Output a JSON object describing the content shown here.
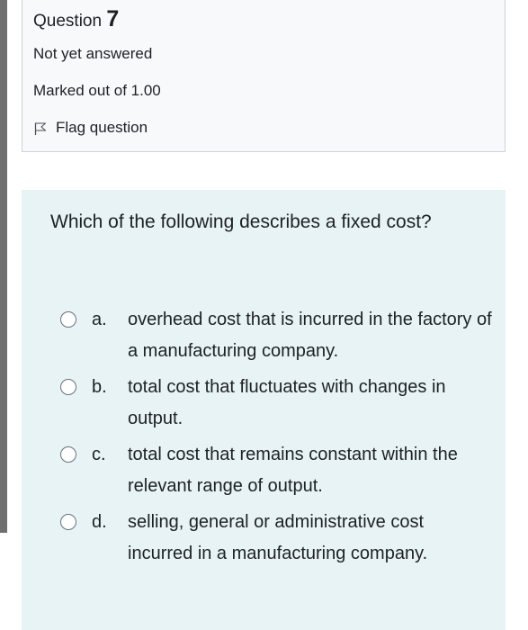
{
  "question": {
    "label": "Question",
    "number": "7",
    "state": "Not yet answered",
    "grade": "Marked out of 1.00",
    "flag_label": "Flag question",
    "flag_icon": "flag-icon"
  },
  "formulation": {
    "text": "Which of the following describes a fixed cost?",
    "options": [
      {
        "letter": "a.",
        "text": "overhead cost that is incurred in the factory of a manufacturing company.",
        "selected": false
      },
      {
        "letter": "b.",
        "text": "total cost that fluctuates with changes in output.",
        "selected": false
      },
      {
        "letter": "c.",
        "text": "total cost that remains constant within the relevant range of output.",
        "selected": false
      },
      {
        "letter": "d.",
        "text": "selling, general or administrative cost incurred in a manufacturing company.",
        "selected": false
      }
    ]
  },
  "colors": {
    "info_background": "#f8f9fa",
    "info_border": "#ced4da",
    "formulation_background": "#e7f3f5",
    "left_bar": "#6f6f6f",
    "text": "#1d2125"
  }
}
